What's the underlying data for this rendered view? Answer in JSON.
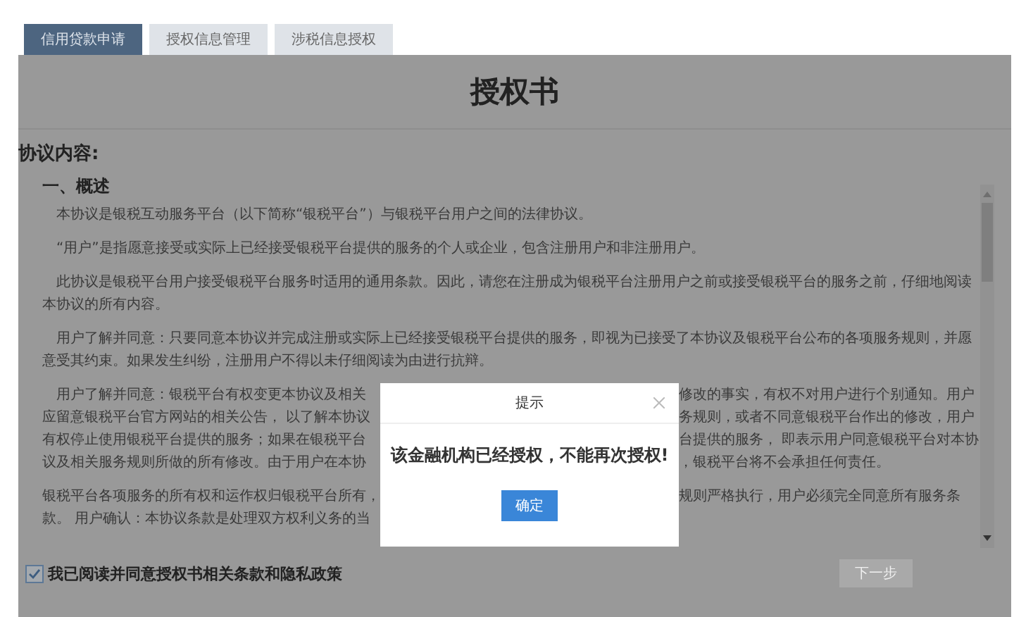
{
  "tabs": [
    {
      "label": "信用贷款申请",
      "selected": true
    },
    {
      "label": "授权信息管理",
      "selected": false
    },
    {
      "label": "涉税信息授权",
      "selected": false
    }
  ],
  "document": {
    "title": "授权书",
    "section_label": "协议内容:",
    "heading": "一、概述",
    "paragraphs": [
      {
        "kind": "full",
        "text": "本协议是银税互动服务平台（以下简称“银税平台”）与银税平台用户之间的法律协议。"
      },
      {
        "kind": "full",
        "text": "“用户”是指愿意接受或实际上已经接受银税平台提供的服务的个人或企业，包含注册用户和非注册用户。"
      },
      {
        "kind": "full",
        "text": "此协议是银税平台用户接受银税平台服务时适用的通用条款。因此，请您在注册成为银税平台注册用户之前或接受银税平台的服务之前，仔细地阅读本协议的所有内容。"
      },
      {
        "kind": "full",
        "text": "用户了解并同意：只要同意本协议并完成注册或实际上已经接受银税平台提供的服务，即视为已接受了本协议及银税平台公布的各项服务规则，并愿意受其约束。如果发生纠纷，注册用户不得以未仔细阅读为由进行抗辩。"
      },
      {
        "kind": "covered",
        "indent": true,
        "lines": [
          {
            "left": "用户了解并同意：银税平台有权变更本协议及相关",
            "right": "修改的事实，有权不对用户进行个别通知。用户"
          },
          {
            "left": "应留意银税平台官方网站的相关公告， 以了解本协议",
            "right": "务规则，或者不同意银税平台作出的修改，用户"
          },
          {
            "left": "有权停止使用银税平台提供的服务；如果在银税平台",
            "right": "台提供的服务， 即表示用户同意银税平台对本协"
          },
          {
            "left": "议及相关服务规则所做的所有修改。由于用户在本协",
            "right": "，银税平台将不会承担任何责任。"
          }
        ]
      },
      {
        "kind": "covered",
        "indent": false,
        "lines": [
          {
            "left": "银税平台各项服务的所有权和运作权归银税平台所有，",
            "right": "规则严格执行，用户必须完全同意所有服务条"
          },
          {
            "left": "款。 用户确认：本协议条款是处理双方权利义务的当"
          }
        ]
      }
    ]
  },
  "agreement": {
    "label": "我已阅读并同意授权书相关条款和隐私政策",
    "checked": true
  },
  "next_button": {
    "label": "下一步",
    "disabled": true
  },
  "dialog": {
    "title": "提示",
    "message": "该金融机构已经授权，不能再次授权!",
    "confirm": "确定"
  }
}
